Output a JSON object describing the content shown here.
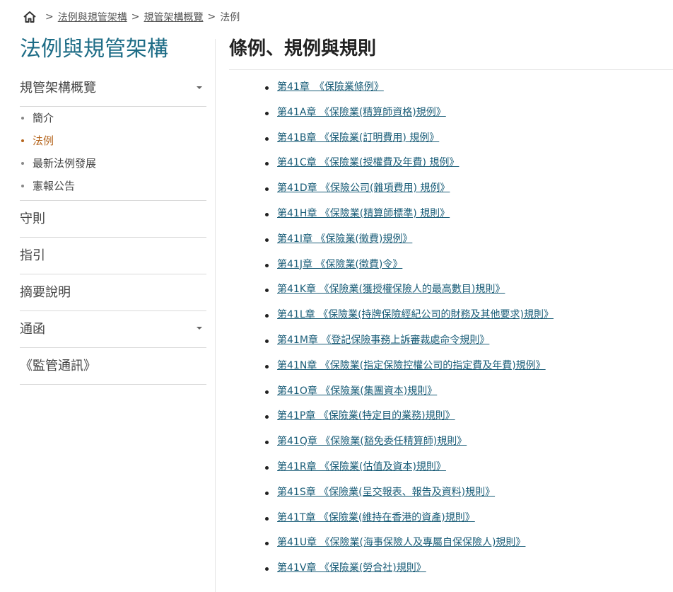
{
  "breadcrumb": {
    "items": [
      "法例與規管架構",
      "規管架構概覽"
    ],
    "current": "法例",
    "separator": ">"
  },
  "sidebar": {
    "title": "法例與規管架構",
    "first_section": "規管架構概覽",
    "sub_items": [
      "簡介",
      "法例",
      "最新法例發展",
      "憲報公告"
    ],
    "active_sub": "法例",
    "sections": [
      "守則",
      "指引",
      "摘要說明",
      "通函",
      "《監管通訊》"
    ]
  },
  "main": {
    "title": "條例、規例與規則",
    "ordinances": [
      "第41章　《保險業條例》",
      "第41A章 《保險業(精算師資格)規例》",
      "第41B章 《保險業(訂明費用) 規例》",
      "第41C章 《保險業(授權費及年費) 規例》",
      "第41D章 《保險公司(雜項費用) 規例》",
      "第41H章 《保險業(精算師標準) 規則》",
      "第41I章 《保險業(徵費)規例》",
      "第41J章 《保險業(徵費)令》",
      "第41K章 《保險業(獲授權保險人的最高數目)規則》",
      "第41L章 《保險業(持牌保險經紀公司的財務及其他要求)規則》",
      "第41M章 《登記保險事務上訴審裁處命令規則》",
      "第41N章 《保險業(指定保險控權公司的指定費及年費)規例》",
      "第41O章 《保險業(集團資本)規則》",
      "第41P章 《保險業(特定目的業務)規則》",
      "第41Q章 《保險業(豁免委任精算師)規則》",
      "第41R章 《保險業(估值及資本)規則》",
      "第41S章 《保險業(呈交報表、報告及資料)規則》",
      "第41T章 《保險業(維持在香港的資產)規則》",
      "第41U章 《保險業(海事保險人及專屬自保保險人)規則》",
      "第41V章 《保險業(勞合社)規則》"
    ]
  },
  "icons": {
    "home": "home-icon",
    "dropdown": "chevron-down-icon"
  },
  "colors": {
    "brand": "#1d6c86",
    "active": "#b5651d",
    "link": "#1a5d78"
  }
}
